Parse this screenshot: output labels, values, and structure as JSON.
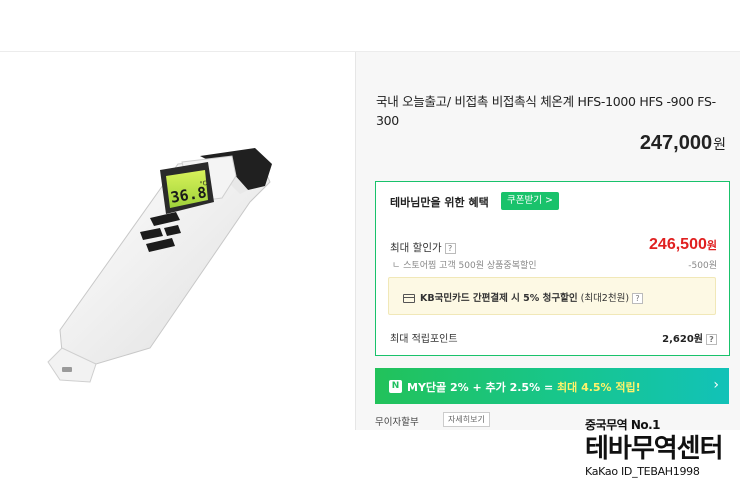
{
  "product": {
    "title": "국내 오늘출고/ 비접촉 비접촉식 체온계 HFS-1000 HFS -900 FS-300",
    "price": "247,000",
    "price_unit": "원"
  },
  "benefit": {
    "heading": "테바님만을 위한 혜택",
    "coupon_label": "쿠폰받기 >",
    "max_discount_label": "최대 할인가",
    "max_discount_price": "246,500",
    "price_unit": "원",
    "store_discount_label": "ㄴ 스토어찜 고객 500원 상품중복할인",
    "store_discount_value": "-500원",
    "kb_prefix": "KB국민카드 간편결제 시 5% 청구할인",
    "kb_suffix": "(최대2천원)",
    "points_label": "최대 적립포인트",
    "points_value": "2,620원",
    "help_glyph": "?"
  },
  "membership": {
    "badge": "N",
    "text_main": "MY단골 2% + 추가 2.5% = ",
    "text_highlight": "최대 4.5% 적립!",
    "arrow": "›"
  },
  "installment": {
    "label": "무이자할부",
    "detail_button": "자세히보기"
  },
  "thermometer": {
    "display_value": "36.8",
    "display_unit": "°C"
  },
  "watermark": {
    "top": "중국무역 No.1",
    "main": "테바무역센터",
    "sub": "KaKao ID_TEBAH1998"
  },
  "colors": {
    "accent_green": "#19c26b",
    "discount_red": "#e02020",
    "highlight_yellow": "#fff36a"
  }
}
